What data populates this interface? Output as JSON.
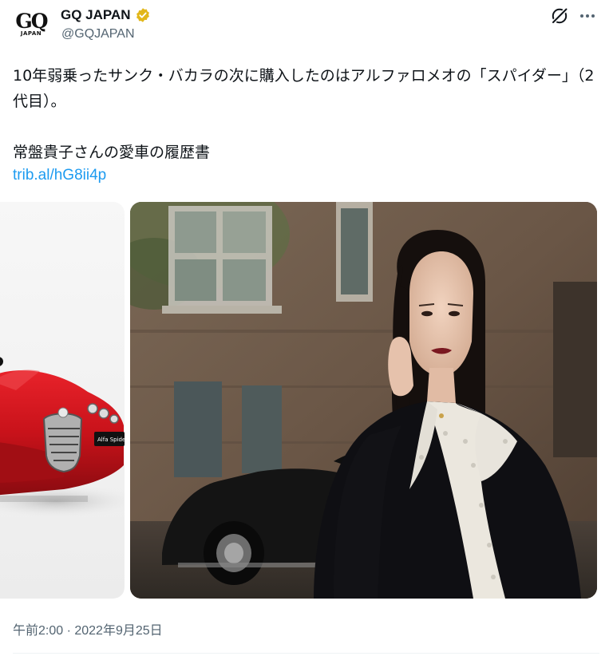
{
  "account": {
    "display_name": "GQ JAPAN",
    "handle": "@GQJAPAN",
    "avatar_logo": "GQ",
    "avatar_sub": "JAPAN",
    "verified_color": "#e2b719"
  },
  "tweet": {
    "text": "10年弱乗ったサンク・バカラの次に購入したのはアルファロメオの「スパイダー」（2代目）。\n\n常盤貴子さんの愛車の履歴書",
    "link": "trib.al/hG8ii4p",
    "timestamp": "午前2:00 · 2022年9月25日"
  },
  "media": {
    "left_plate": "Alfa Spider",
    "car_color": "#d0151b"
  },
  "colors": {
    "link": "#1d9bf0",
    "secondary_text": "#536471"
  },
  "icons": [
    "verified-badge-icon",
    "grok-icon",
    "more-options-icon"
  ]
}
